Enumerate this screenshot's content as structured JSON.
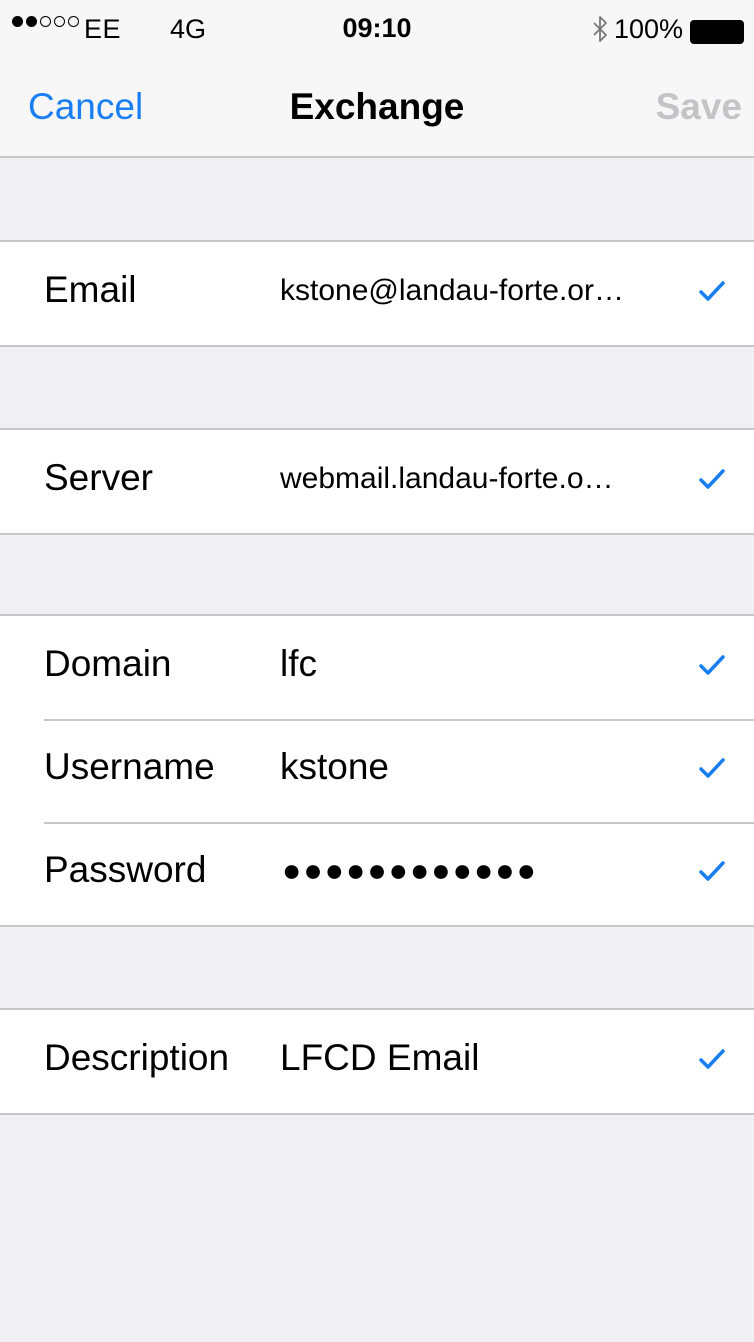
{
  "status_bar": {
    "carrier": "EE",
    "network": "4G",
    "time": "09:10",
    "battery": "100%",
    "signal_bars_filled": 2,
    "signal_bars_total": 5
  },
  "nav": {
    "cancel_label": "Cancel",
    "title": "Exchange",
    "save_label": "Save"
  },
  "account": {
    "email_label": "Email",
    "email_value": "kstone@landau-forte.or…",
    "server_label": "Server",
    "server_value": "webmail.landau-forte.o…",
    "domain_label": "Domain",
    "domain_value": "lfc",
    "username_label": "Username",
    "username_value": "kstone",
    "password_label": "Password",
    "password_value": "●●●●●●●●●●●●",
    "description_label": "Description",
    "description_value": "LFCD Email"
  },
  "colors": {
    "accent": "#1a7ef3",
    "disabled": "#c4c4c7",
    "background": "#efeff4"
  },
  "icons": {
    "validated": "checkmark-icon",
    "bluetooth": "bluetooth-icon",
    "battery": "battery-icon"
  }
}
